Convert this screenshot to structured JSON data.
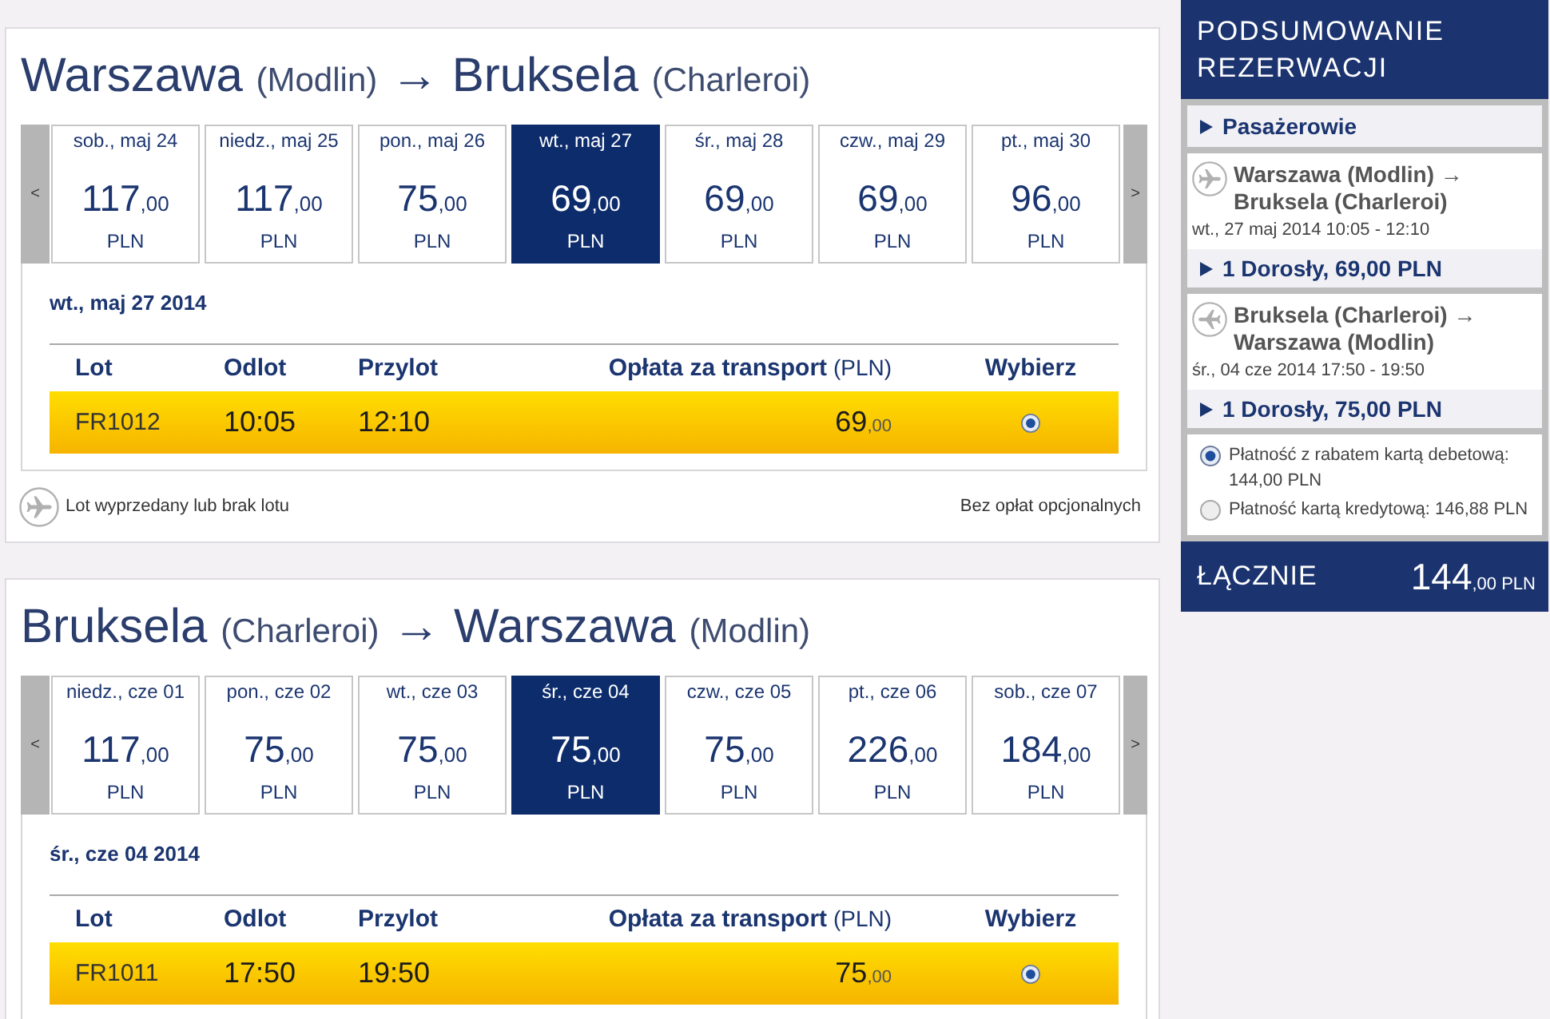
{
  "journeys": [
    {
      "route": {
        "from_city": "Warszawa",
        "from_airport": "(Modlin)",
        "arrow": "→",
        "to_city": "Bruksela",
        "to_airport": "(Charleroi)"
      },
      "prev": "<",
      "next": ">",
      "dates": [
        {
          "label": "sob., maj 24",
          "amount": "117",
          "fraction": ",00",
          "currency": "PLN",
          "selected": false
        },
        {
          "label": "niedz., maj 25",
          "amount": "117",
          "fraction": ",00",
          "currency": "PLN",
          "selected": false
        },
        {
          "label": "pon., maj 26",
          "amount": "75",
          "fraction": ",00",
          "currency": "PLN",
          "selected": false
        },
        {
          "label": "wt., maj 27",
          "amount": "69",
          "fraction": ",00",
          "currency": "PLN",
          "selected": true
        },
        {
          "label": "śr., maj 28",
          "amount": "69",
          "fraction": ",00",
          "currency": "PLN",
          "selected": false
        },
        {
          "label": "czw., maj 29",
          "amount": "69",
          "fraction": ",00",
          "currency": "PLN",
          "selected": false
        },
        {
          "label": "pt., maj 30",
          "amount": "96",
          "fraction": ",00",
          "currency": "PLN",
          "selected": false
        }
      ],
      "selected_date": "wt., maj 27 2014",
      "columns": [
        {
          "kind": "flight",
          "label": "Lot"
        },
        {
          "kind": "departure",
          "label": "Odlot"
        },
        {
          "kind": "arrival",
          "label": "Przylot"
        },
        {
          "kind": "fare",
          "label": "Opłata za transport",
          "unit": "(PLN)"
        },
        {
          "kind": "select",
          "label": "Wybierz"
        }
      ],
      "flights": [
        {
          "number": "FR1012",
          "departure": "10:05",
          "arrival": "12:10",
          "amount": "69",
          "fraction": ",00",
          "selected": true
        }
      ],
      "legend": {
        "unavailable": "Lot wyprzedany lub brak lotu",
        "fees": "Bez opłat opcjonalnych"
      }
    },
    {
      "route": {
        "from_city": "Bruksela",
        "from_airport": "(Charleroi)",
        "arrow": "→",
        "to_city": "Warszawa",
        "to_airport": "(Modlin)"
      },
      "prev": "<",
      "next": ">",
      "dates": [
        {
          "label": "niedz., cze 01",
          "amount": "117",
          "fraction": ",00",
          "currency": "PLN",
          "selected": false
        },
        {
          "label": "pon., cze 02",
          "amount": "75",
          "fraction": ",00",
          "currency": "PLN",
          "selected": false
        },
        {
          "label": "wt., cze 03",
          "amount": "75",
          "fraction": ",00",
          "currency": "PLN",
          "selected": false
        },
        {
          "label": "śr., cze 04",
          "amount": "75",
          "fraction": ",00",
          "currency": "PLN",
          "selected": true
        },
        {
          "label": "czw., cze 05",
          "amount": "75",
          "fraction": ",00",
          "currency": "PLN",
          "selected": false
        },
        {
          "label": "pt., cze 06",
          "amount": "226",
          "fraction": ",00",
          "currency": "PLN",
          "selected": false
        },
        {
          "label": "sob., cze 07",
          "amount": "184",
          "fraction": ",00",
          "currency": "PLN",
          "selected": false
        }
      ],
      "selected_date": "śr., cze 04 2014",
      "columns": [
        {
          "kind": "flight",
          "label": "Lot"
        },
        {
          "kind": "departure",
          "label": "Odlot"
        },
        {
          "kind": "arrival",
          "label": "Przylot"
        },
        {
          "kind": "fare",
          "label": "Opłata za transport",
          "unit": "(PLN)"
        },
        {
          "kind": "select",
          "label": "Wybierz"
        }
      ],
      "flights": [
        {
          "number": "FR1011",
          "departure": "17:50",
          "arrival": "19:50",
          "amount": "75",
          "fraction": ",00",
          "selected": true
        }
      ]
    }
  ],
  "summary": {
    "title": "PODSUMOWANIE REZERWACJI",
    "passengers": "Pasażerowie",
    "legs": [
      {
        "kind": "outbound",
        "route": "Warszawa (Modlin) → Bruksela (Charleroi)",
        "when": "wt., 27 maj 2014 10:05 - 12:10",
        "fare": "1 Dorosły, 69,00 PLN"
      },
      {
        "kind": "return",
        "route": "Bruksela (Charleroi) → Warszawa (Modlin)",
        "when": "śr., 04 cze 2014 17:50 - 19:50",
        "fare": "1 Dorosły, 75,00 PLN"
      }
    ],
    "payment_options": [
      {
        "label": "Płatność z rabatem kartą debetową: 144,00 PLN",
        "selected": true
      },
      {
        "label": "Płatność kartą kredytową: 146,88 PLN",
        "selected": false
      }
    ],
    "total": {
      "label": "ŁĄCZNIE",
      "amount": "144",
      "fraction": ",00",
      "currency": "PLN"
    }
  }
}
